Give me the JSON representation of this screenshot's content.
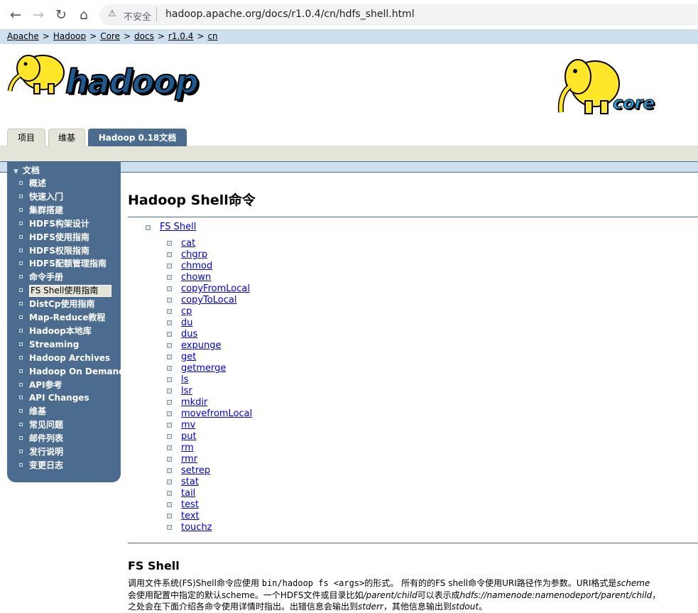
{
  "browser": {
    "insecure_label": "不安全",
    "url": "hadoop.apache.org/docs/r1.0.4/cn/hdfs_shell.html"
  },
  "breadcrumb": [
    "Apache",
    "Hadoop",
    "Core",
    "docs",
    "r1.0.4",
    "cn"
  ],
  "logos": {
    "hadoop": "hadoop",
    "core": "core"
  },
  "tabs": [
    {
      "label": "项目",
      "active": false
    },
    {
      "label": "维基",
      "active": false
    },
    {
      "label": "Hadoop 0.18文档",
      "active": true
    }
  ],
  "sidebar": {
    "heading": "文档",
    "items": [
      "概述",
      "快速入门",
      "集群搭建",
      "HDFS构架设计",
      "HDFS使用指南",
      "HDFS权限指南",
      "HDFS配额管理指南",
      "命令手册",
      "FS Shell使用指南",
      "DistCp使用指南",
      "Map-Reduce教程",
      "Hadoop本地库",
      "Streaming",
      "Hadoop Archives",
      "Hadoop On Demand",
      "API参考",
      "API Changes",
      "维基",
      "常见问题",
      "邮件列表",
      "发行说明",
      "变更日志"
    ],
    "current_index": 8
  },
  "content": {
    "title": "Hadoop Shell命令",
    "toc_top": "FS Shell",
    "toc_items": [
      "cat",
      "chgrp",
      "chmod",
      "chown",
      "copyFromLocal",
      "copyToLocal",
      "cp",
      "du",
      "dus",
      "expunge",
      "get",
      "getmerge",
      "ls",
      "lsr",
      "mkdir",
      "movefromLocal",
      "mv",
      "put",
      "rm",
      "rmr",
      "setrep",
      "stat",
      "tail",
      "test",
      "text",
      "touchz"
    ],
    "section_title": "FS Shell",
    "para": {
      "l1a": "调用文件系统(FS)Shell命令应使用 ",
      "l1code": "bin/hadoop fs <args>",
      "l1b": "的形式。 所有的的FS shell命令使用URI路径作为参数。URI格式是",
      "l1i": "scheme",
      "l2a": "会使用配置中指定的默认scheme。一个HDFS文件或目录比如",
      "l2i1": "/parent/child",
      "l2b": "可以表示成",
      "l2i2": "hdfs://namenode:namenodeport/parent/child",
      "l2c": "，",
      "l3a": "之处会在下面介绍各命令使用详情时指出。出错信息会输出到",
      "l3i1": "stderr",
      "l3b": "，其他信息输出到",
      "l3i2": "stdout",
      "l3c": "。"
    }
  },
  "colors": {
    "nav": "#4c6c8f",
    "crumb_bg": "#cedfef",
    "tab_bg": "#e5e4d9",
    "link": "#0000cc"
  }
}
